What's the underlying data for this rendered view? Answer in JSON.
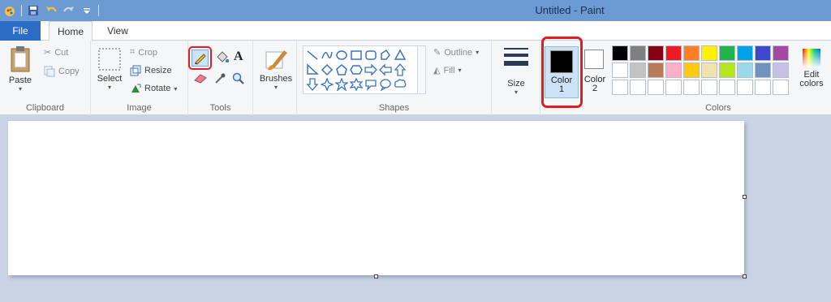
{
  "window": {
    "title": "Untitled - Paint"
  },
  "tabs": [
    {
      "label": "File"
    },
    {
      "label": "Home"
    },
    {
      "label": "View"
    }
  ],
  "clipboard": {
    "paste": "Paste",
    "cut": "Cut",
    "copy": "Copy",
    "group": "Clipboard"
  },
  "image": {
    "select": "Select",
    "crop": "Crop",
    "resize": "Resize",
    "rotate": "Rotate",
    "group": "Image"
  },
  "tools": {
    "group": "Tools",
    "selected": "pencil"
  },
  "brushes": {
    "label": "Brushes"
  },
  "shapes": {
    "outline": "Outline",
    "fill": "Fill",
    "group": "Shapes"
  },
  "size": {
    "label": "Size"
  },
  "colors": {
    "color1_line1": "Color",
    "color1_line2": "1",
    "color2_line1": "Color",
    "color2_line2": "2",
    "edit_line1": "Edit",
    "edit_line2": "colors",
    "group": "Colors",
    "color1_value": "#000000",
    "color2_value": "#ffffff",
    "palette_row1": [
      "#000000",
      "#7f7f7f",
      "#880015",
      "#ed1c24",
      "#ff7f27",
      "#fff200",
      "#22b14c",
      "#00a2e8",
      "#3f48cc",
      "#a349a4"
    ],
    "palette_row2": [
      "#ffffff",
      "#c3c3c3",
      "#b97a57",
      "#ffaec9",
      "#ffc90e",
      "#efe4b0",
      "#b5e61d",
      "#99d9ea",
      "#7092be",
      "#c8bfe7"
    ]
  }
}
